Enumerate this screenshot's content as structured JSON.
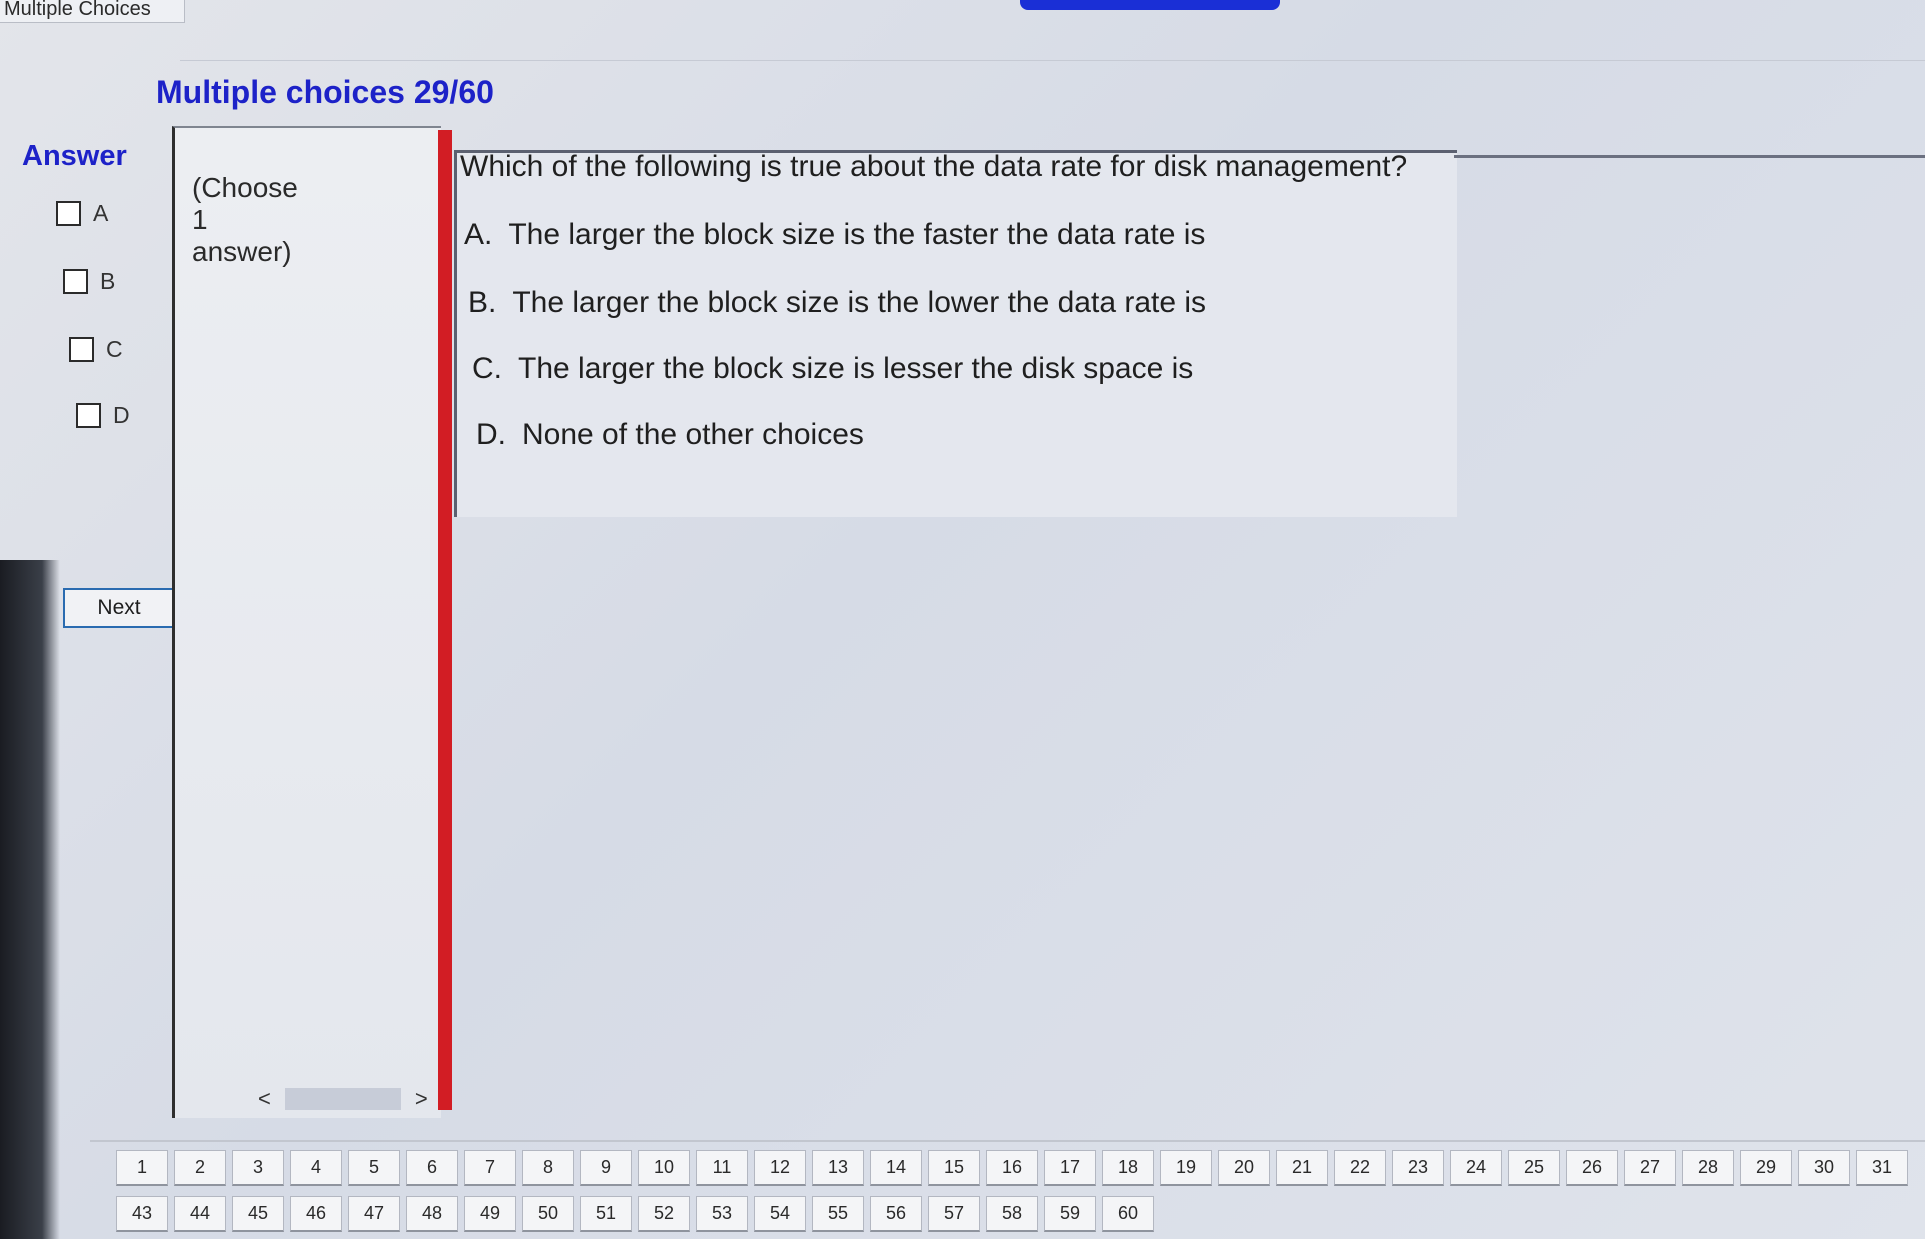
{
  "window": {
    "tab_title": "Multiple Choices"
  },
  "header": {
    "title": "Multiple choices 29/60"
  },
  "answer_panel": {
    "label": "Answer",
    "options": [
      "A",
      "B",
      "C",
      "D"
    ],
    "next_label": "Next"
  },
  "instruction": {
    "line1": "(Choose",
    "line2": "1",
    "line3": "answer)"
  },
  "scrollbar": {
    "left_arrow": "<",
    "right_arrow": ">"
  },
  "question": {
    "text": "Which of the following is true about the data rate for disk management?",
    "choices": [
      {
        "letter": "A.",
        "text": "The larger the block size is the faster the data rate is"
      },
      {
        "letter": "B.",
        "text": "The larger the block size is the lower the data rate is"
      },
      {
        "letter": "C.",
        "text": "The larger the block size is lesser the disk space is"
      },
      {
        "letter": "D.",
        "text": "None of the other choices"
      }
    ]
  },
  "question_nav": {
    "row1": [
      "1",
      "2",
      "3",
      "4",
      "5",
      "6",
      "7",
      "8",
      "9",
      "10",
      "11",
      "12",
      "13",
      "14",
      "15",
      "16",
      "17",
      "18",
      "19",
      "20",
      "21",
      "22",
      "23",
      "24",
      "25",
      "26",
      "27",
      "28",
      "29",
      "30",
      "31"
    ],
    "row2": [
      "43",
      "44",
      "45",
      "46",
      "47",
      "48",
      "49",
      "50",
      "51",
      "52",
      "53",
      "54",
      "55",
      "56",
      "57",
      "58",
      "59",
      "60"
    ]
  },
  "colors": {
    "title_blue": "#1d22c8",
    "red_bar": "#d21d24",
    "button_border": "#2a6bb0"
  }
}
